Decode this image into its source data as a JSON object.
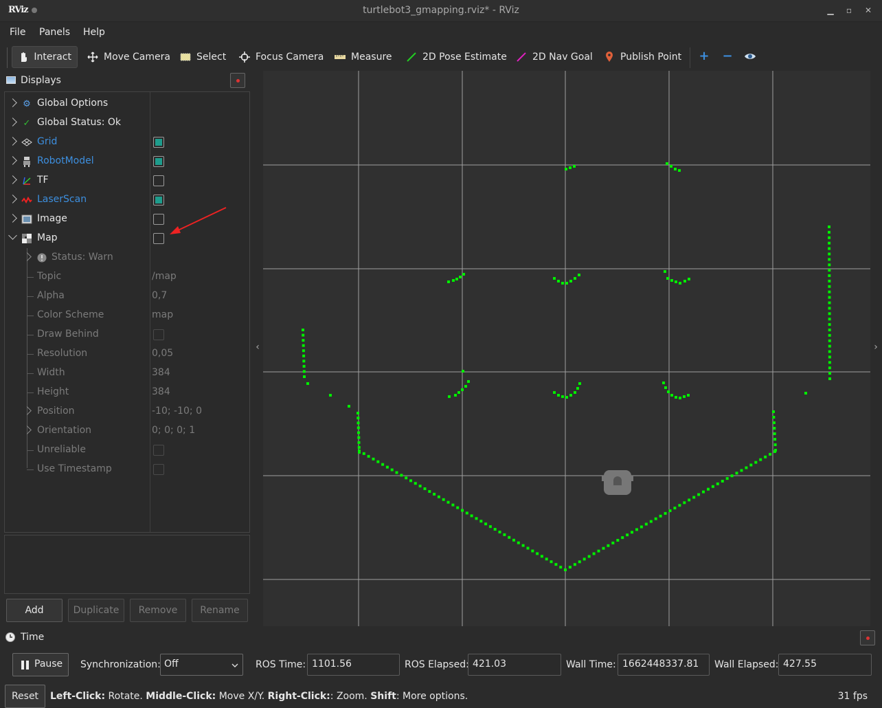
{
  "window": {
    "logo": "RViz",
    "title": "turtlebot3_gmapping.rviz* - RViz",
    "minimize_icon": "minimize-icon",
    "maximize_icon": "maximize-icon",
    "close_icon": "close-icon"
  },
  "menubar": {
    "file": "File",
    "panels": "Panels",
    "help": "Help"
  },
  "toolbar": {
    "interact": "Interact",
    "move_camera": "Move Camera",
    "select": "Select",
    "focus_camera": "Focus Camera",
    "measure": "Measure",
    "pose_estimate": "2D Pose Estimate",
    "nav_goal": "2D Nav Goal",
    "publish_point": "Publish Point",
    "zoom_in": "+",
    "zoom_out": "−",
    "eye": "eye-icon"
  },
  "displays": {
    "title": "Displays",
    "items": [
      {
        "label": "Global Options",
        "icon": "gear-icon"
      },
      {
        "label": "Global Status: Ok",
        "icon": "check-icon"
      },
      {
        "label": "Grid",
        "icon": "grid-icon",
        "enabled": true
      },
      {
        "label": "RobotModel",
        "icon": "robot-icon",
        "enabled": true
      },
      {
        "label": "TF",
        "icon": "axes-icon",
        "enabled": false
      },
      {
        "label": "LaserScan",
        "icon": "laserscan-icon",
        "enabled": true
      },
      {
        "label": "Image",
        "icon": "image-icon",
        "enabled": false
      },
      {
        "label": "Map",
        "icon": "map-icon",
        "enabled": false
      }
    ],
    "map_props": [
      {
        "label": "Status: Warn",
        "value": ""
      },
      {
        "label": "Topic",
        "value": "/map"
      },
      {
        "label": "Alpha",
        "value": "0,7"
      },
      {
        "label": "Color Scheme",
        "value": "map"
      },
      {
        "label": "Draw Behind",
        "value": ""
      },
      {
        "label": "Resolution",
        "value": "0,05"
      },
      {
        "label": "Width",
        "value": "384"
      },
      {
        "label": "Height",
        "value": "384"
      },
      {
        "label": "Position",
        "value": "-10; -10; 0"
      },
      {
        "label": "Orientation",
        "value": "0; 0; 0; 1"
      },
      {
        "label": "Unreliable",
        "value": ""
      },
      {
        "label": "Use Timestamp",
        "value": ""
      }
    ],
    "buttons": {
      "add": "Add",
      "duplicate": "Duplicate",
      "remove": "Remove",
      "rename": "Rename"
    }
  },
  "time": {
    "title": "Time",
    "pause": "Pause",
    "sync_label": "Synchronization:",
    "sync_value": "Off",
    "ros_time_label": "ROS Time:",
    "ros_time": "1101.56",
    "ros_elapsed_label": "ROS Elapsed:",
    "ros_elapsed": "421.03",
    "wall_time_label": "Wall Time:",
    "wall_time": "1662448337.81",
    "wall_elapsed_label": "Wall Elapsed:",
    "wall_elapsed": "427.55"
  },
  "status": {
    "reset": "Reset",
    "left_click": "Left-Click:",
    "left_click_desc": " Rotate. ",
    "middle_click": "Middle-Click:",
    "middle_click_desc": " Move X/Y. ",
    "right_click": "Right-Click:",
    "right_click_desc": ": Zoom. ",
    "shift": "Shift",
    "shift_desc": ": More options.",
    "fps": "31 fps"
  },
  "colors": {
    "laser": "#00ee00",
    "accent": "#3d8fdf",
    "checkbox": "#1e9c8c"
  }
}
